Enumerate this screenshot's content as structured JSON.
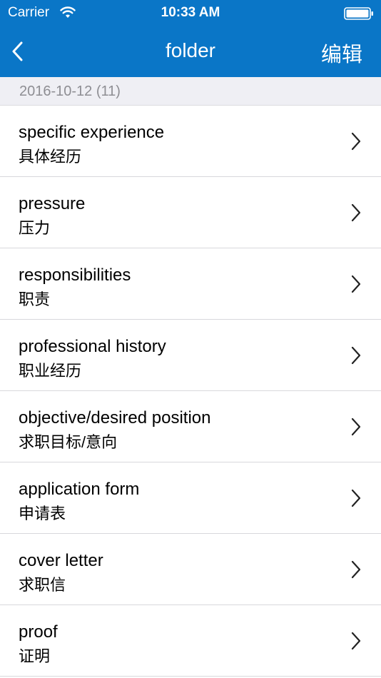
{
  "status_bar": {
    "carrier": "Carrier",
    "time": "10:33 AM"
  },
  "nav": {
    "title": "folder",
    "edit_label": "编辑"
  },
  "section": {
    "header": "2016-10-12 (11)"
  },
  "items": [
    {
      "en": "specific experience",
      "zh": "具体经历"
    },
    {
      "en": "pressure",
      "zh": "压力"
    },
    {
      "en": "responsibilities",
      "zh": "职责"
    },
    {
      "en": "professional history",
      "zh": "职业经历"
    },
    {
      "en": "objective/desired position",
      "zh": "求职目标/意向"
    },
    {
      "en": "application form",
      "zh": "申请表"
    },
    {
      "en": "cover letter",
      "zh": "求职信"
    },
    {
      "en": "proof",
      "zh": "证明"
    }
  ],
  "colors": {
    "nav_background": "#0a76c7",
    "section_background": "#efeff4",
    "section_text": "#8e8e93"
  },
  "icons": {
    "back": "chevron-left-icon",
    "row_disclosure": "chevron-right-icon",
    "wifi": "wifi-icon",
    "battery": "battery-icon"
  }
}
